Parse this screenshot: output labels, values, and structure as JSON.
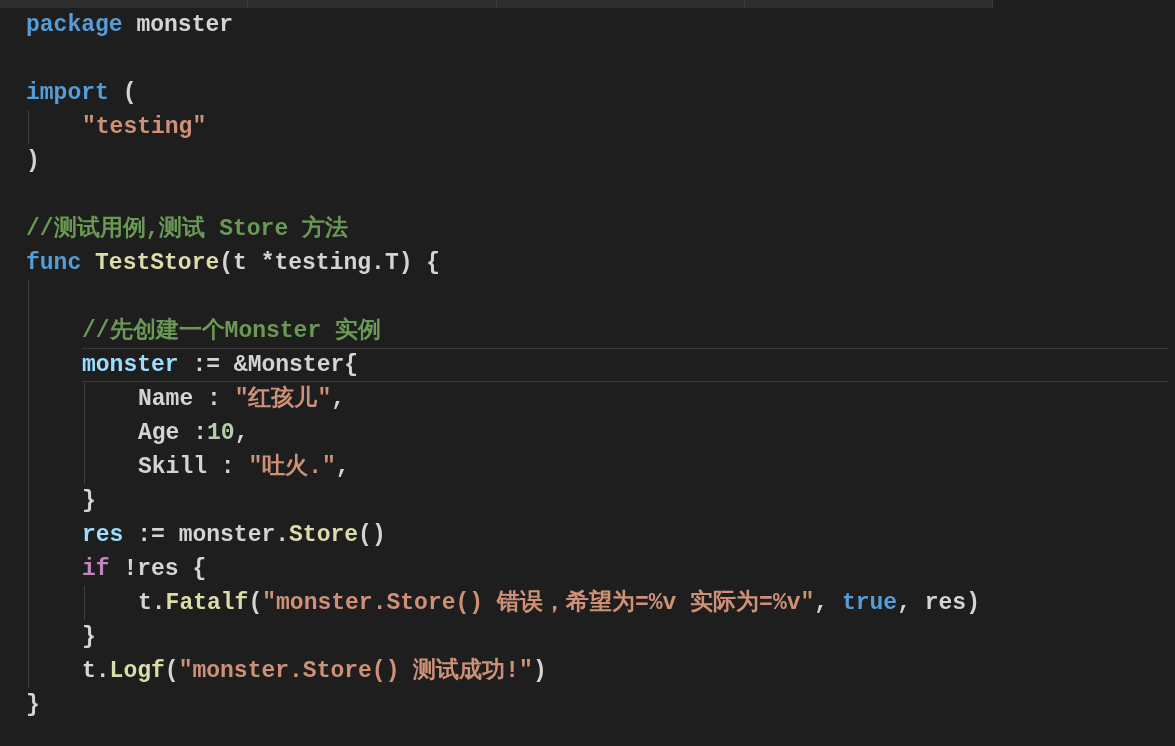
{
  "editor": {
    "lines": [
      {
        "kind": "code",
        "current": false,
        "tokens": [
          {
            "text": "package",
            "kind": "keyword"
          },
          {
            "text": " monster",
            "kind": "plain"
          }
        ]
      },
      {
        "kind": "blank"
      },
      {
        "kind": "code",
        "current": false,
        "tokens": [
          {
            "text": "import",
            "kind": "keyword"
          },
          {
            "text": " (",
            "kind": "plain"
          }
        ],
        "children": [
          {
            "kind": "code",
            "current": false,
            "tokens": [
              {
                "text": "\"testing\"",
                "kind": "string"
              }
            ]
          }
        ]
      },
      {
        "kind": "code",
        "current": false,
        "tokens": [
          {
            "text": ")",
            "kind": "plain"
          }
        ]
      },
      {
        "kind": "blank"
      },
      {
        "kind": "code",
        "current": false,
        "tokens": [
          {
            "text": "//测试用例,测试 Store 方法",
            "kind": "comment"
          }
        ]
      },
      {
        "kind": "code",
        "current": false,
        "tokens": [
          {
            "text": "func",
            "kind": "keyword"
          },
          {
            "text": " TestStore",
            "kind": "function"
          },
          {
            "text": "(t *testing.T) {",
            "kind": "plain"
          }
        ],
        "children": [
          {
            "kind": "blank"
          },
          {
            "kind": "code",
            "current": false,
            "tokens": [
              {
                "text": "//先创建一个Monster 实例",
                "kind": "comment"
              }
            ]
          },
          {
            "kind": "code",
            "current": true,
            "tokens": [
              {
                "text": "monster",
                "kind": "variable"
              },
              {
                "text": " := &Monster{",
                "kind": "plain"
              }
            ],
            "children": [
              {
                "kind": "code",
                "current": false,
                "tokens": [
                  {
                    "text": "Name : ",
                    "kind": "plain"
                  },
                  {
                    "text": "\"红孩儿\"",
                    "kind": "string"
                  },
                  {
                    "text": ",",
                    "kind": "plain"
                  }
                ]
              },
              {
                "kind": "code",
                "current": false,
                "tokens": [
                  {
                    "text": "Age :",
                    "kind": "plain"
                  },
                  {
                    "text": "10",
                    "kind": "number"
                  },
                  {
                    "text": ",",
                    "kind": "plain"
                  }
                ]
              },
              {
                "kind": "code",
                "current": false,
                "tokens": [
                  {
                    "text": "Skill : ",
                    "kind": "plain"
                  },
                  {
                    "text": "\"吐火.\"",
                    "kind": "string"
                  },
                  {
                    "text": ",",
                    "kind": "plain"
                  }
                ]
              }
            ]
          },
          {
            "kind": "code",
            "current": false,
            "tokens": [
              {
                "text": "}",
                "kind": "plain"
              }
            ]
          },
          {
            "kind": "code",
            "current": false,
            "tokens": [
              {
                "text": "res",
                "kind": "variable"
              },
              {
                "text": " := monster.",
                "kind": "plain"
              },
              {
                "text": "Store",
                "kind": "function"
              },
              {
                "text": "()",
                "kind": "plain"
              }
            ]
          },
          {
            "kind": "code",
            "current": false,
            "tokens": [
              {
                "text": "if",
                "kind": "control"
              },
              {
                "text": " !res {",
                "kind": "plain"
              }
            ],
            "children": [
              {
                "kind": "code",
                "current": false,
                "tokens": [
                  {
                    "text": "t.",
                    "kind": "plain"
                  },
                  {
                    "text": "Fatalf",
                    "kind": "function"
                  },
                  {
                    "text": "(",
                    "kind": "plain"
                  },
                  {
                    "text": "\"monster.Store() 错误，希望为=%v 实际为=%v\"",
                    "kind": "string"
                  },
                  {
                    "text": ", ",
                    "kind": "plain"
                  },
                  {
                    "text": "true",
                    "kind": "keyword"
                  },
                  {
                    "text": ", res)",
                    "kind": "plain"
                  }
                ]
              }
            ]
          },
          {
            "kind": "code",
            "current": false,
            "tokens": [
              {
                "text": "}",
                "kind": "plain"
              }
            ]
          },
          {
            "kind": "code",
            "current": false,
            "tokens": [
              {
                "text": "t.",
                "kind": "plain"
              },
              {
                "text": "Logf",
                "kind": "function"
              },
              {
                "text": "(",
                "kind": "plain"
              },
              {
                "text": "\"monster.Store() 测试成功!\"",
                "kind": "string"
              },
              {
                "text": ")",
                "kind": "plain"
              }
            ]
          }
        ]
      },
      {
        "kind": "code",
        "current": false,
        "tokens": [
          {
            "text": "}",
            "kind": "plain"
          }
        ]
      }
    ]
  }
}
